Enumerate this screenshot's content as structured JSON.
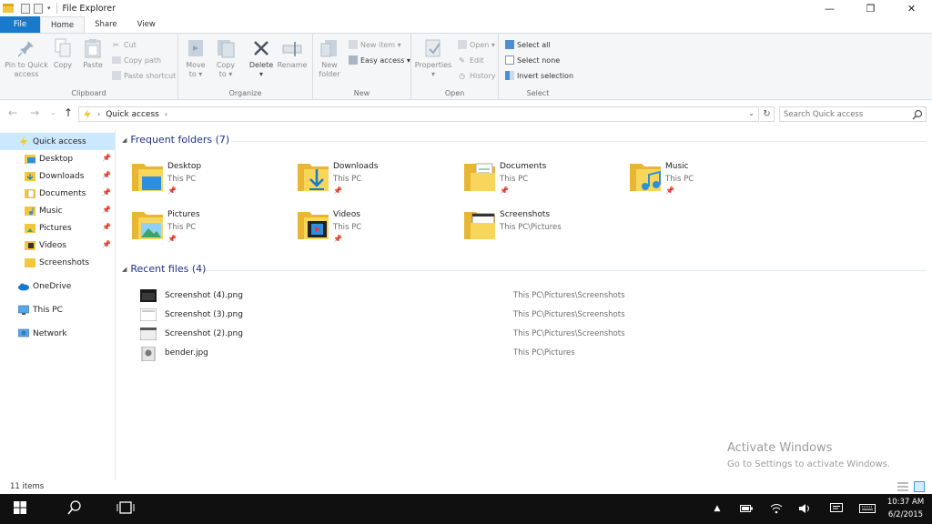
{
  "window": {
    "title": "File Explorer",
    "minimize": "—",
    "restore": "❐",
    "close": "✕"
  },
  "tabs": [
    {
      "label": "File"
    },
    {
      "label": "Home"
    },
    {
      "label": "Share"
    },
    {
      "label": "View"
    }
  ],
  "ribbon": {
    "clipboard": {
      "label": "Clipboard",
      "pin": "Pin to Quick\naccess",
      "copy": "Copy",
      "paste": "Paste",
      "cut": "Cut",
      "copy_path": "Copy path",
      "paste_shortcut": "Paste shortcut"
    },
    "organize": {
      "label": "Organize",
      "move_to": "Move\nto ▾",
      "copy_to": "Copy\nto ▾",
      "delete": "Delete\n▾",
      "rename": "Rename"
    },
    "new": {
      "label": "New",
      "new_folder": "New\nfolder",
      "new_item": "New item ▾",
      "easy_access": "Easy access ▾"
    },
    "open": {
      "label": "Open",
      "properties": "Properties\n▾",
      "open": "Open ▾",
      "edit": "Edit",
      "history": "History"
    },
    "select": {
      "label": "Select",
      "select_all": "Select all",
      "select_none": "Select none",
      "invert_selection": "Invert selection"
    }
  },
  "address": {
    "back": "←",
    "forward": "→",
    "recent": "⌄",
    "up": "↑",
    "path": "Quick access",
    "chevron": "›",
    "dropdown": "⌄",
    "refresh": "↻",
    "search_placeholder": "Search Quick access"
  },
  "nav": {
    "quick_access": "Quick access",
    "pin_glyph": "📌",
    "items": [
      {
        "label": "Desktop",
        "pinned": true
      },
      {
        "label": "Downloads",
        "pinned": true
      },
      {
        "label": "Documents",
        "pinned": true
      },
      {
        "label": "Music",
        "pinned": true
      },
      {
        "label": "Pictures",
        "pinned": true
      },
      {
        "label": "Videos",
        "pinned": true
      },
      {
        "label": "Screenshots",
        "pinned": false
      }
    ],
    "onedrive": "OneDrive",
    "this_pc": "This PC",
    "network": "Network"
  },
  "content": {
    "frequent_heading": "Frequent folders (7)",
    "recent_heading": "Recent files (4)",
    "caret": "◢",
    "folders": [
      {
        "name": "Desktop",
        "location": "This PC",
        "pinned": true
      },
      {
        "name": "Downloads",
        "location": "This PC",
        "pinned": true
      },
      {
        "name": "Documents",
        "location": "This PC",
        "pinned": true
      },
      {
        "name": "Music",
        "location": "This PC",
        "pinned": true
      },
      {
        "name": "Pictures",
        "location": "This PC",
        "pinned": true
      },
      {
        "name": "Videos",
        "location": "This PC",
        "pinned": true
      },
      {
        "name": "Screenshots",
        "location": "This PC\\Pictures",
        "pinned": false
      }
    ],
    "files": [
      {
        "name": "Screenshot (4).png",
        "path": "This PC\\Pictures\\Screenshots"
      },
      {
        "name": "Screenshot (3).png",
        "path": "This PC\\Pictures\\Screenshots"
      },
      {
        "name": "Screenshot (2).png",
        "path": "This PC\\Pictures\\Screenshots"
      },
      {
        "name": "bender.jpg",
        "path": "This PC\\Pictures"
      }
    ]
  },
  "watermark": {
    "line1": "Activate Windows",
    "line2": "Go to Settings to activate Windows."
  },
  "status": {
    "item_count": "11 items"
  },
  "taskbar": {
    "time": "10:37 AM",
    "date": "6/2/2015",
    "tray_up": "▲"
  },
  "colors": {
    "accent": "#1979ca",
    "folder_yellow": "#f3c73c",
    "selection": "#cce8ff",
    "heading_blue": "#1e3287"
  }
}
